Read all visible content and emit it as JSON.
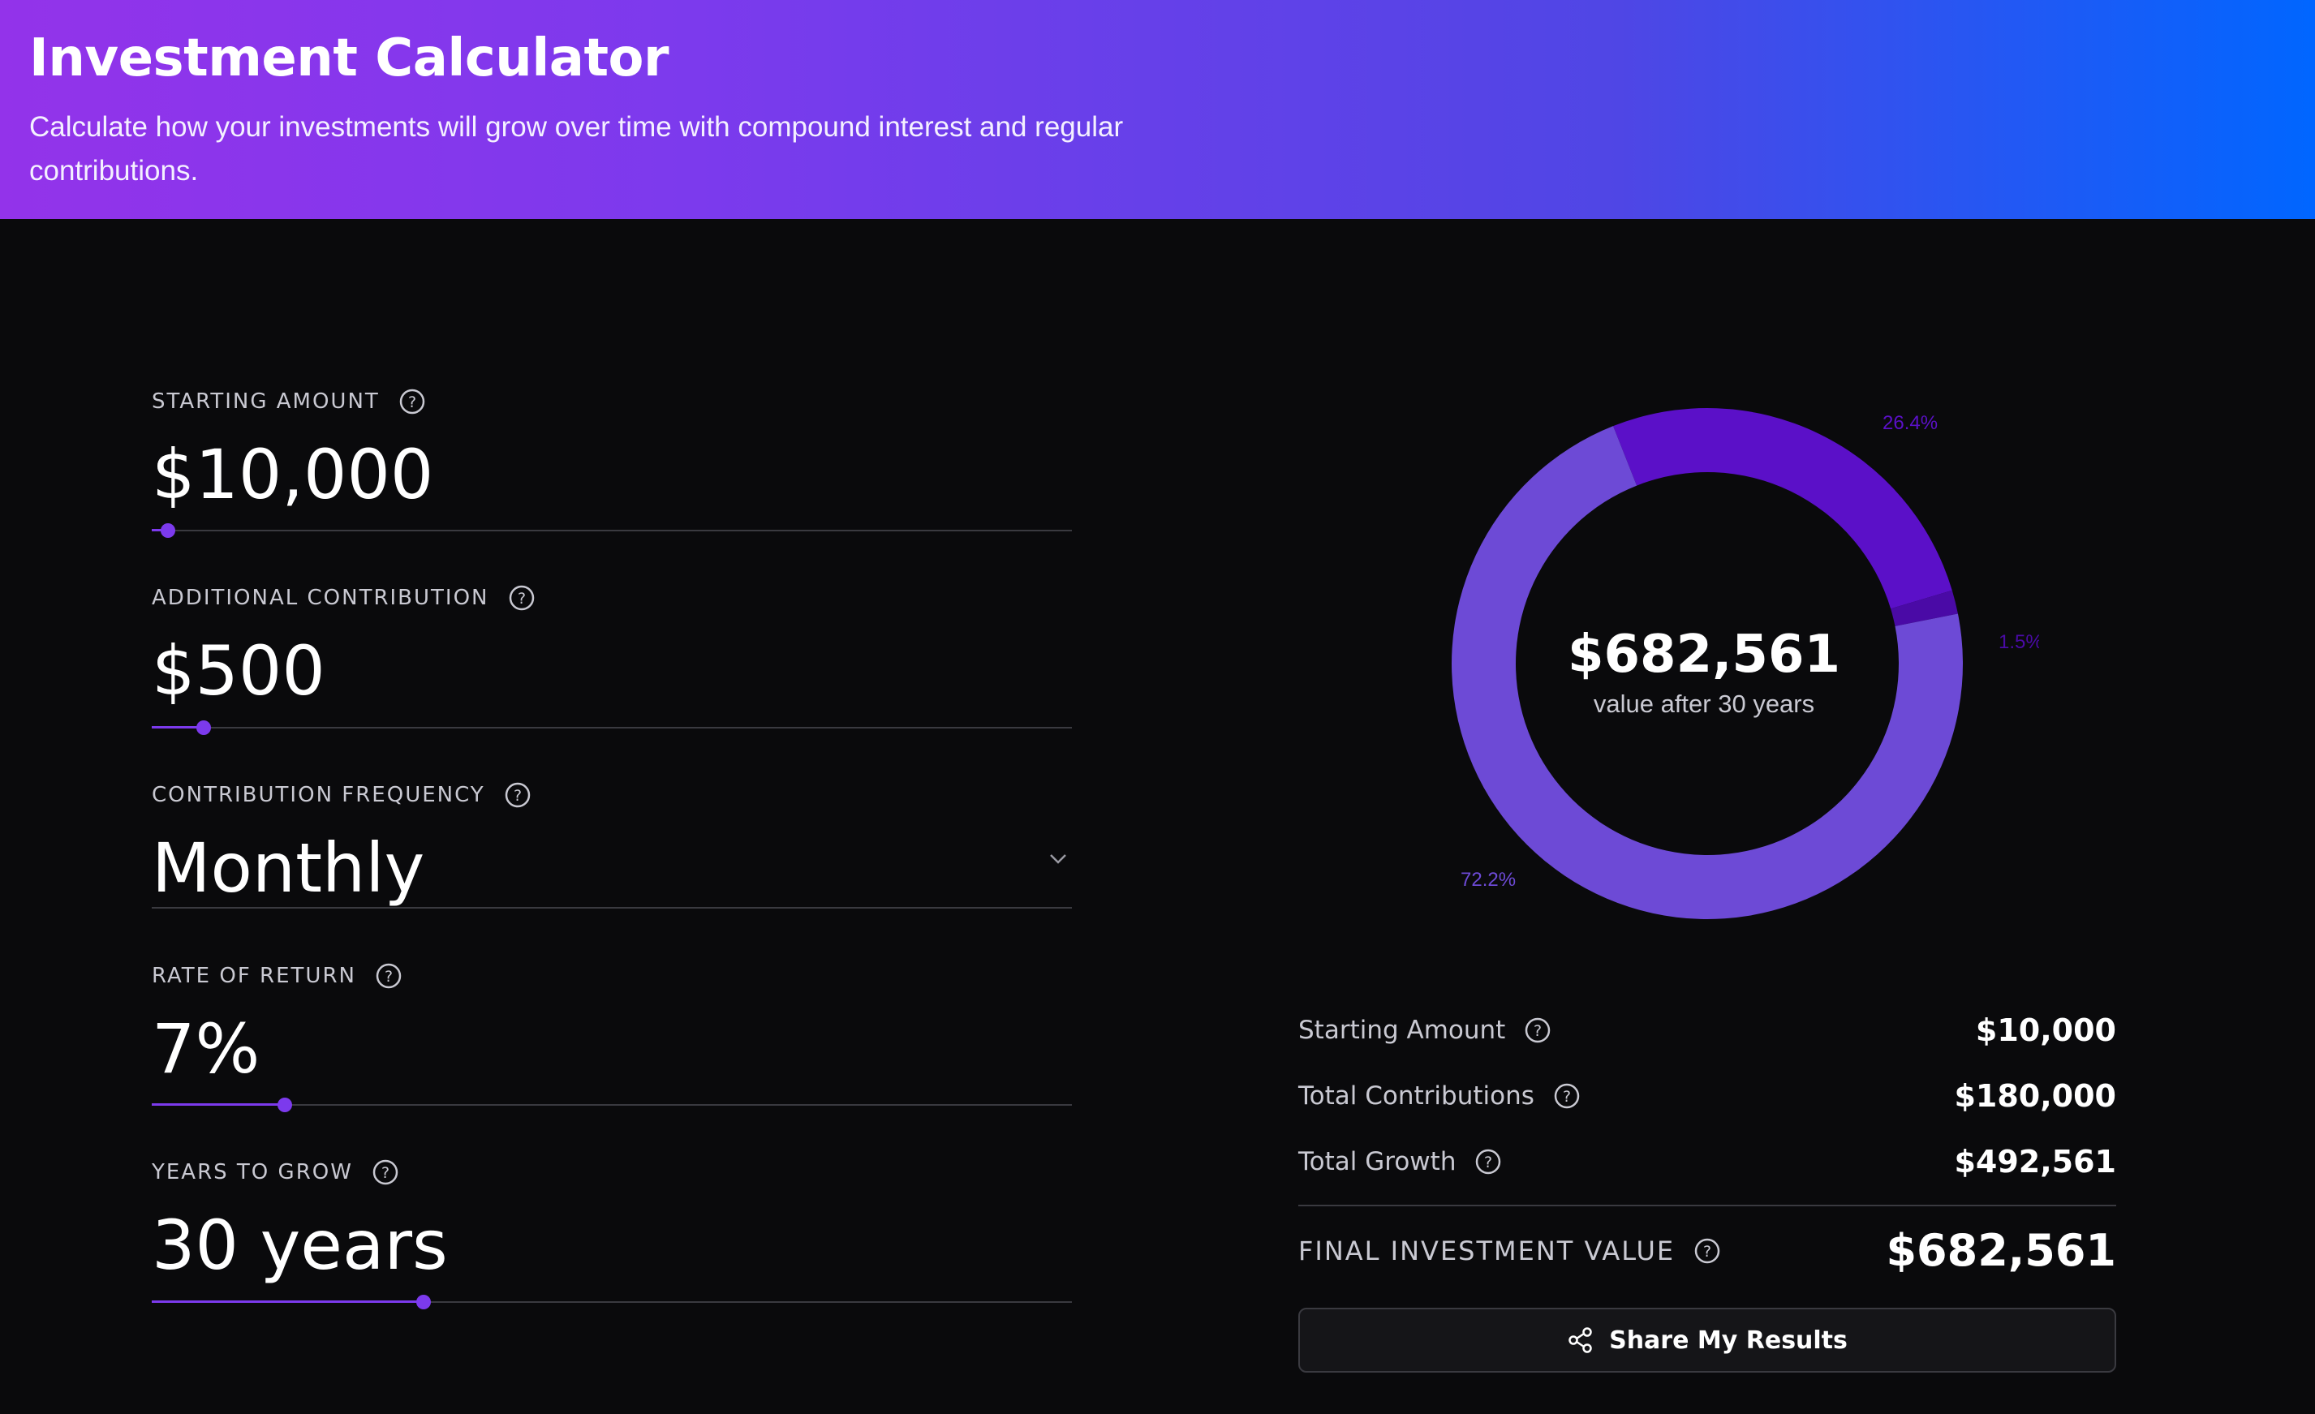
{
  "header": {
    "title": "Investment Calculator",
    "subtitle": "Calculate how your investments will grow over time with compound interest and regular contributions."
  },
  "inputs": {
    "starting_amount": {
      "label": "STARTING AMOUNT",
      "value": "$10,000",
      "slider_fraction": 0.018
    },
    "additional_contribution": {
      "label": "ADDITIONAL CONTRIBUTION",
      "value": "$500",
      "slider_fraction": 0.056
    },
    "contribution_frequency": {
      "label": "CONTRIBUTION FREQUENCY",
      "value": "Monthly"
    },
    "rate_of_return": {
      "label": "RATE OF RETURN",
      "value": "7%",
      "slider_fraction": 0.145
    },
    "years_to_grow": {
      "label": "YEARS TO GROW",
      "value": "30 years",
      "slider_fraction": 0.295
    }
  },
  "chart_data": {
    "type": "pie",
    "categories": [
      "Total Growth",
      "Starting Amount",
      "Total Contributions"
    ],
    "values": [
      26.4,
      1.5,
      72.2
    ],
    "labels": [
      "26.4%",
      "1.5%",
      "72.2%"
    ],
    "colors": [
      "#5b10c8",
      "#4a0aa6",
      "#6d4ad6"
    ],
    "center_value": "$682,561",
    "center_subtitle": "value after 30 years"
  },
  "summary": {
    "starting_amount": {
      "label": "Starting Amount",
      "value": "$10,000"
    },
    "total_contributions": {
      "label": "Total Contributions",
      "value": "$180,000"
    },
    "total_growth": {
      "label": "Total Growth",
      "value": "$492,561"
    },
    "final_value": {
      "label": "FINAL INVESTMENT VALUE",
      "value": "$682,561"
    }
  },
  "share_button": {
    "label": "Share My Results",
    "icon": "share-icon"
  },
  "colors": {
    "accent": "#7c3aed",
    "background": "#0a0a0c"
  }
}
